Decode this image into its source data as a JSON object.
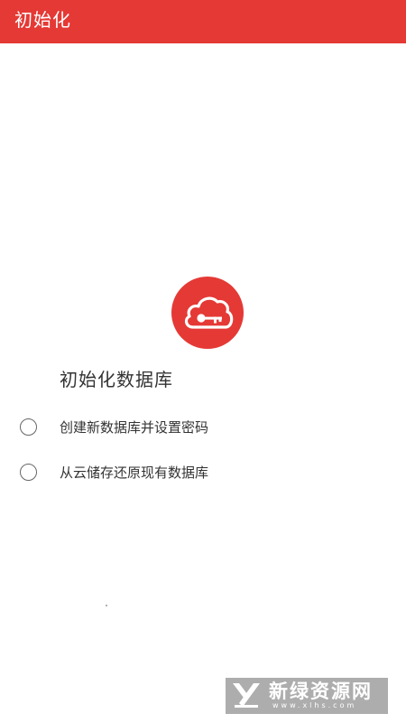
{
  "app_bar": {
    "title": "初始化",
    "color": "#e53935"
  },
  "logo": {
    "icon": "cloud-key-icon",
    "color": "#e53935"
  },
  "main": {
    "heading": "初始化数据库",
    "options": [
      {
        "label": "创建新数据库并设置密码",
        "selected": false
      },
      {
        "label": "从云储存还原现有数据库",
        "selected": false
      }
    ]
  },
  "watermark": {
    "title": "新绿资源网",
    "url": "www.xlhs.com"
  }
}
